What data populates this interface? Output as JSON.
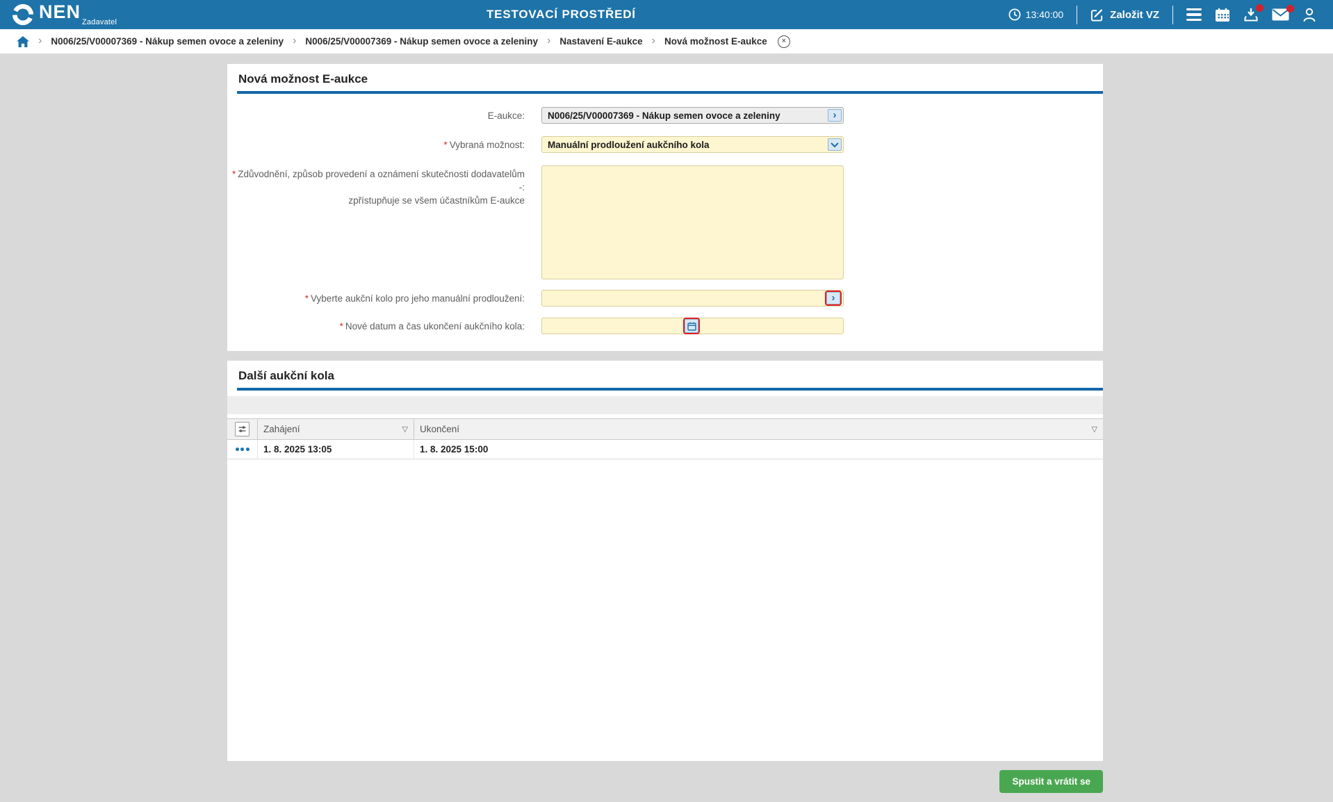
{
  "header": {
    "logo_text": "NEN",
    "logo_subtitle": "Zadavatel",
    "environment_title": "TESTOVACÍ PROSTŘEDÍ",
    "time": "13:40:00",
    "create_vz_label": "Založit VZ",
    "icons": [
      "clock-icon",
      "edit-icon",
      "menu-icon",
      "calendar-icon",
      "inbox-download-icon",
      "mail-icon",
      "user-icon"
    ],
    "notification_badges": [
      "inbox-download-icon",
      "mail-icon"
    ]
  },
  "breadcrumb": {
    "items": [
      {
        "label": "N006/25/V00007369 - Nákup semen ovoce a zeleniny"
      },
      {
        "label": "N006/25/V00007369 - Nákup semen ovoce a zeleniny"
      },
      {
        "label": "Nastavení E-aukce"
      },
      {
        "label": "Nová možnost E-aukce"
      }
    ],
    "close_glyph": "×"
  },
  "form_panel": {
    "title": "Nová možnost E-aukce",
    "required_marker": "*",
    "fields": {
      "eaukce": {
        "label": "E-aukce:",
        "value": "N006/25/V00007369 - Nákup semen ovoce a zeleniny"
      },
      "vybrana_moznost": {
        "label": "Vybraná možnost:",
        "value": "Manuální prodloužení aukčního kola"
      },
      "zduvodneni": {
        "label_line1": "Zdůvodnění, způsob provedení a oznámení skutečnosti dodavatelům -:",
        "label_line2": "zpřístupňuje se všem účastníkům E-aukce",
        "value": ""
      },
      "aukcni_kolo": {
        "label": "Vyberte aukční kolo pro jeho manuální prodloužení:",
        "value": ""
      },
      "nove_datum": {
        "label": "Nové datum a čas ukončení aukčního kola:",
        "value": ""
      }
    }
  },
  "table_panel": {
    "title": "Další aukční kola",
    "columns": [
      {
        "label": "Zahájení",
        "sort_glyph": "▽"
      },
      {
        "label": "Ukončení",
        "sort_glyph": "▽"
      }
    ],
    "rows": [
      {
        "zahajeni": "1. 8. 2025 13:05",
        "ukonceni": "1. 8. 2025 15:00"
      }
    ]
  },
  "footer": {
    "submit_label": "Spustit a vrátit se"
  },
  "colors": {
    "header_blue": "#1E73A8",
    "section_underline_blue": "#1467A8",
    "field_yellow": "#FDF6D0",
    "field_yellow_border": "#D9CE9C",
    "field_gray": "#EDEDED",
    "mini_button_blue_bg": "#D9E7F5",
    "link_blue": "#1A6FA8",
    "focus_red": "#E02020",
    "badge_red": "#D3222A",
    "submit_green": "#4AA751"
  }
}
